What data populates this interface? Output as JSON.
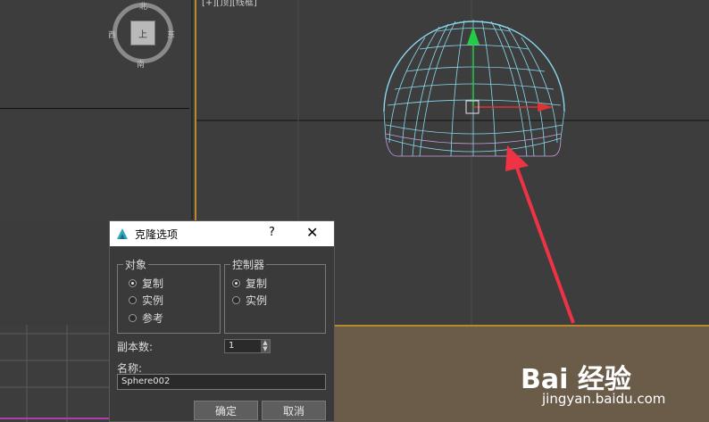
{
  "viewports": {
    "top_label": "[+][顶][线框]",
    "viewcube": {
      "north": "北",
      "south": "南",
      "west": "西",
      "east": "东",
      "face": "上"
    }
  },
  "dialog": {
    "title": "克隆选项",
    "help": "?",
    "close": "✕",
    "object_group": {
      "title": "对象",
      "options": [
        "复制",
        "实例",
        "参考"
      ],
      "selected": "复制"
    },
    "controller_group": {
      "title": "控制器",
      "options": [
        "复制",
        "实例"
      ],
      "selected": "复制"
    },
    "copies_label": "副本数:",
    "copies_value": "1",
    "name_label": "名称:",
    "name_value": "Sphere002",
    "ok_label": "确定",
    "cancel_label": "取消"
  },
  "colors": {
    "viewport_bg": "#3d3d3d",
    "active_border": "#b88a2a",
    "wireframe": "#88d8ee",
    "wireframe_alt": "#c9a0e0",
    "arrow": "#ee3344"
  },
  "watermark": {
    "brand": "Bai  经验",
    "url": "jingyan.baidu.com"
  }
}
